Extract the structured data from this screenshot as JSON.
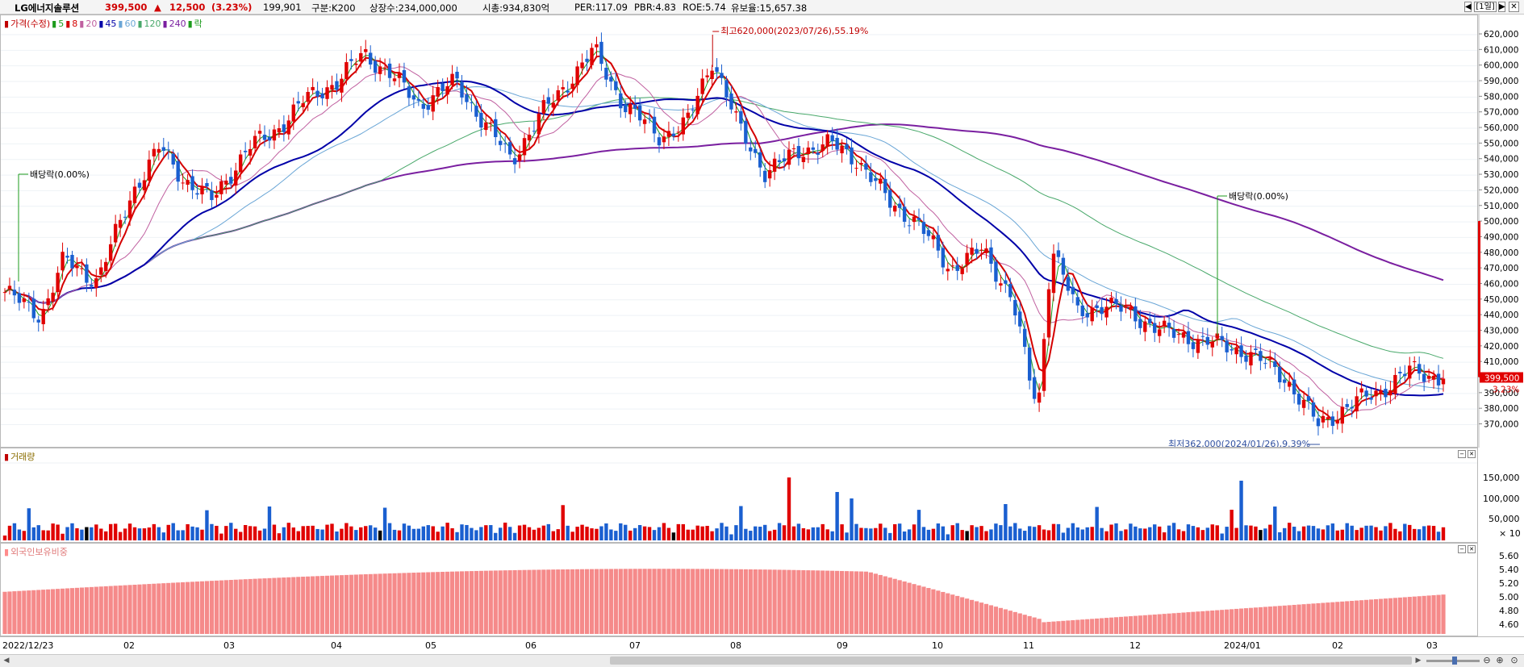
{
  "header": {
    "name": "LG에너지솔루션",
    "price": "399,500",
    "change_arrow": "▲",
    "change": "12,500",
    "change_pct": "(3.23%)",
    "volume": "199,901",
    "category": "구분:K200",
    "listed": "상장수:234,000,000",
    "mcap": "시총:934,830억",
    "per": "PER:117.09",
    "pbr": "PBR:4.83",
    "roe": "ROE:5.74",
    "float": "유보율:15,657.38",
    "period_button": "[1일]"
  },
  "price_legend": [
    {
      "label": "가격(수정)",
      "color": "#c00000"
    },
    {
      "label": "5",
      "color": "#1c9b1c"
    },
    {
      "label": "8",
      "color": "#d40000"
    },
    {
      "label": "20",
      "color": "#c060a0"
    },
    {
      "label": "45",
      "color": "#0000a8"
    },
    {
      "label": "60",
      "color": "#6aa6d6"
    },
    {
      "label": "120",
      "color": "#48a86a"
    },
    {
      "label": "240",
      "color": "#7a1fa0"
    },
    {
      "label": "락",
      "color": "#1c9b1c"
    }
  ],
  "volume_panel": {
    "title": "거래량",
    "ticks": [
      "150,000",
      "100,000",
      "50,000"
    ],
    "unit": "× 10"
  },
  "foreign_panel": {
    "title": "외국인보유비중",
    "ticks": [
      "5.60",
      "5.40",
      "5.20",
      "5.00",
      "4.80",
      "4.60"
    ]
  },
  "annotations": {
    "high": "최고620,000(2023/07/26),55.19%",
    "low": "최저362,000(2024/01/26),9.39%",
    "dividend1": "배당락(0.00%)",
    "dividend2": "배당락(0.00%)",
    "price_tag": "399,500",
    "pct_tag": "3.23%"
  },
  "chart_data": {
    "type": "candlestick",
    "symbol": "LG에너지솔루션",
    "period": "daily",
    "ylim": [
      362000,
      620000
    ],
    "y_ticks": [
      370000,
      380000,
      390000,
      400000,
      410000,
      420000,
      430000,
      440000,
      450000,
      460000,
      470000,
      480000,
      490000,
      500000,
      510000,
      520000,
      530000,
      540000,
      550000,
      560000,
      570000,
      580000,
      590000,
      600000,
      610000,
      620000
    ],
    "x_labels": [
      "2022/12/23",
      "02",
      "03",
      "04",
      "05",
      "06",
      "07",
      "08",
      "09",
      "10",
      "11",
      "12",
      "2024/01",
      "02",
      "03"
    ],
    "close_path": [
      {
        "d": "2022/12/23",
        "close": 455000
      },
      {
        "d": "2023/01/03",
        "close": 440000
      },
      {
        "d": "2023/01/10",
        "close": 476000
      },
      {
        "d": "2023/01/20",
        "close": 462000
      },
      {
        "d": "2023/01/31",
        "close": 520000
      },
      {
        "d": "2023/02/08",
        "close": 548000
      },
      {
        "d": "2023/02/15",
        "close": 528000
      },
      {
        "d": "2023/02/24",
        "close": 514000
      },
      {
        "d": "2023/03/07",
        "close": 548000
      },
      {
        "d": "2023/03/14",
        "close": 556000
      },
      {
        "d": "2023/03/24",
        "close": 578000
      },
      {
        "d": "2023/04/03",
        "close": 590000
      },
      {
        "d": "2023/04/11",
        "close": 608000
      },
      {
        "d": "2023/04/19",
        "close": 595000
      },
      {
        "d": "2023/04/28",
        "close": 575000
      },
      {
        "d": "2023/05/09",
        "close": 590000
      },
      {
        "d": "2023/05/17",
        "close": 565000
      },
      {
        "d": "2023/05/26",
        "close": 540000
      },
      {
        "d": "2023/06/05",
        "close": 572000
      },
      {
        "d": "2023/06/13",
        "close": 592000
      },
      {
        "d": "2023/06/20",
        "close": 610000
      },
      {
        "d": "2023/06/29",
        "close": 575000
      },
      {
        "d": "2023/07/10",
        "close": 555000
      },
      {
        "d": "2023/07/18",
        "close": 562000
      },
      {
        "d": "2023/07/26",
        "close": 605000
      },
      {
        "d": "2023/08/03",
        "close": 560000
      },
      {
        "d": "2023/08/11",
        "close": 532000
      },
      {
        "d": "2023/08/22",
        "close": 546000
      },
      {
        "d": "2023/08/31",
        "close": 550000
      },
      {
        "d": "2023/09/08",
        "close": 540000
      },
      {
        "d": "2023/09/18",
        "close": 512000
      },
      {
        "d": "2023/09/26",
        "close": 500000
      },
      {
        "d": "2023/10/06",
        "close": 470000
      },
      {
        "d": "2023/10/16",
        "close": 482000
      },
      {
        "d": "2023/10/25",
        "close": 452000
      },
      {
        "d": "2023/10/31",
        "close": 392000
      },
      {
        "d": "2023/11/02",
        "close": 382000
      },
      {
        "d": "2023/11/06",
        "close": 486000
      },
      {
        "d": "2023/11/14",
        "close": 440000
      },
      {
        "d": "2023/11/22",
        "close": 448000
      },
      {
        "d": "2023/12/01",
        "close": 440000
      },
      {
        "d": "2023/12/12",
        "close": 428000
      },
      {
        "d": "2023/12/22",
        "close": 424000
      },
      {
        "d": "2024/01/05",
        "close": 416000
      },
      {
        "d": "2024/01/16",
        "close": 400000
      },
      {
        "d": "2024/01/26",
        "close": 370000
      },
      {
        "d": "2024/02/05",
        "close": 383000
      },
      {
        "d": "2024/02/14",
        "close": 392000
      },
      {
        "d": "2024/02/23",
        "close": 405000
      },
      {
        "d": "2024/03/04",
        "close": 399500
      }
    ],
    "ma_series": [
      {
        "name": "5",
        "color": "#1c9b1c"
      },
      {
        "name": "8",
        "color": "#d40000"
      },
      {
        "name": "20",
        "color": "#c060a0"
      },
      {
        "name": "45",
        "color": "#0000a8"
      },
      {
        "name": "60",
        "color": "#6aa6d6"
      },
      {
        "name": "120",
        "color": "#48a86a"
      },
      {
        "name": "240",
        "color": "#7a1fa0"
      }
    ],
    "high_marker": {
      "date": "2023/07/26",
      "value": 620000
    },
    "low_marker": {
      "date": "2024/01/26",
      "value": 362000
    }
  }
}
